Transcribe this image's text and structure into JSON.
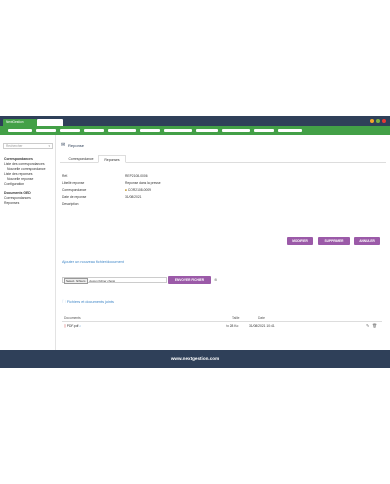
{
  "app": {
    "tab_label": "NextGestion"
  },
  "window_dots": [
    "#f4a52a",
    "#7cb342",
    "#e53935"
  ],
  "sidebar": {
    "search_placeholder": "Rechercher",
    "items": [
      {
        "label": "Correspondances",
        "style": "bold"
      },
      {
        "label": "Liste des correspondances",
        "style": "normal"
      },
      {
        "label": "Nouvelle correspondance",
        "style": "sub"
      },
      {
        "label": "Liste des reponses",
        "style": "normal"
      },
      {
        "label": "Nouvelle reponse",
        "style": "sub"
      },
      {
        "label": "Configuration",
        "style": "normal"
      },
      {
        "label": "Documents GED",
        "style": "bold"
      },
      {
        "label": "Correspondances",
        "style": "normal"
      },
      {
        "label": "Reponses",
        "style": "normal"
      }
    ]
  },
  "page": {
    "title": "Reponse",
    "tabs": [
      "Correspondance",
      "Reponses"
    ]
  },
  "fields": [
    {
      "label": "Réf.",
      "value": "REP2108-0006"
    },
    {
      "label": "Libellé reponse",
      "value": "Reponse dans la presse"
    },
    {
      "label": "Correspondance",
      "value": "COR2108-0009"
    },
    {
      "label": "Date de reponse",
      "value": "31/08/2021"
    },
    {
      "label": "Description",
      "value": ""
    }
  ],
  "actions": {
    "modify": "MODIFIER",
    "delete": "SUPPRIMER",
    "cancel": "ANNULER"
  },
  "upload": {
    "title": "Ajouter un nouveau fichier/document",
    "choose_label": "Select. fichiers",
    "no_file": "Aucun fichier choisi",
    "send_label": "ENVOYER FICHIER"
  },
  "files": {
    "title": "Fichiers et documents joints",
    "headers": {
      "documents": "Documents",
      "size": "Taille",
      "date": "Date"
    },
    "rows": [
      {
        "name": "PDF.pdf",
        "size": "28 Ko",
        "date": "31/08/2021 10:41"
      }
    ]
  },
  "footer": {
    "text": "www.nextgestion.com"
  }
}
